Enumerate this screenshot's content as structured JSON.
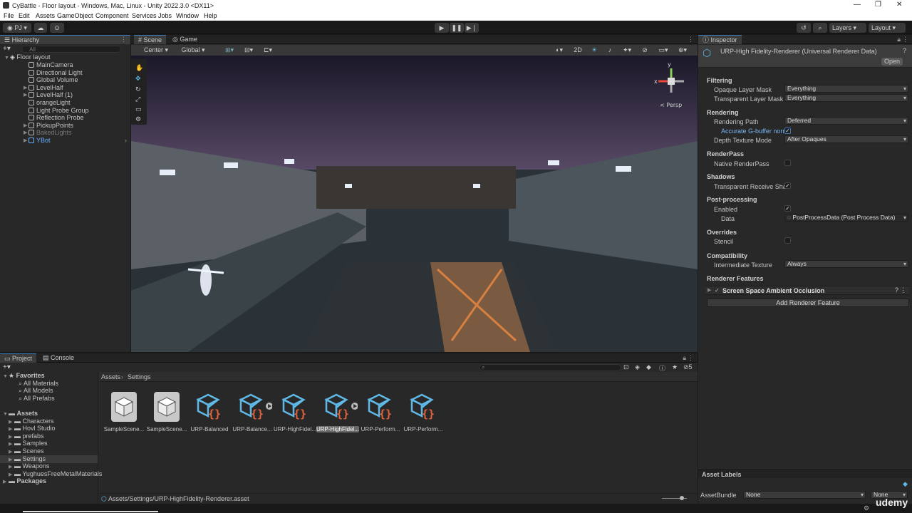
{
  "window": {
    "title": "CyBattle - Floor layout - Windows, Mac, Linux - Unity 2022.3.0 <DX11>"
  },
  "menu": [
    "File",
    "Edit",
    "Assets",
    "GameObject",
    "Component",
    "Services",
    "Jobs",
    "Window",
    "Help"
  ],
  "toolbar": {
    "account": "PJ",
    "layers": "Layers",
    "layout": "Layout"
  },
  "hierarchy": {
    "tab": "Hierarchy",
    "search_placeholder": "All",
    "root": "Floor layout",
    "items": [
      {
        "label": "MainCamera",
        "arrow": false,
        "dim": false,
        "blue": false
      },
      {
        "label": "Directional Light",
        "arrow": false,
        "dim": false,
        "blue": false
      },
      {
        "label": "Global Volume",
        "arrow": false,
        "dim": false,
        "blue": false
      },
      {
        "label": "LevelHalf",
        "arrow": true,
        "dim": false,
        "blue": false
      },
      {
        "label": "LevelHalf (1)",
        "arrow": true,
        "dim": false,
        "blue": false
      },
      {
        "label": "orangeLight",
        "arrow": false,
        "dim": false,
        "blue": false
      },
      {
        "label": "Light Probe Group",
        "arrow": false,
        "dim": false,
        "blue": false
      },
      {
        "label": "Reflection Probe",
        "arrow": false,
        "dim": false,
        "blue": false
      },
      {
        "label": "PickupPoints",
        "arrow": true,
        "dim": false,
        "blue": false
      },
      {
        "label": "BakedLights",
        "arrow": true,
        "dim": true,
        "blue": false
      },
      {
        "label": "YBot",
        "arrow": true,
        "dim": false,
        "blue": true
      }
    ]
  },
  "scene": {
    "tab_scene": "Scene",
    "tab_game": "Game",
    "pivot": "Center",
    "space": "Global",
    "mode2d": "2D",
    "persp": "< Persp",
    "gizmo_x": "x",
    "gizmo_y": "y"
  },
  "inspector": {
    "tab": "Inspector",
    "title": "URP-High Fidelity-Renderer (Universal Renderer Data)",
    "open": "Open",
    "filtering": "Filtering",
    "opaque_label": "Opaque Layer Mask",
    "opaque_value": "Everything",
    "transparent_label": "Transparent Layer Mask",
    "transparent_value": "Everything",
    "rendering": "Rendering",
    "path_label": "Rendering Path",
    "path_value": "Deferred",
    "gbuffer_label": "Accurate G-buffer norm",
    "depth_label": "Depth Texture Mode",
    "depth_value": "After Opaques",
    "renderpass": "RenderPass",
    "native_label": "Native RenderPass",
    "shadows": "Shadows",
    "trs_label": "Transparent Receive Shac",
    "post": "Post-processing",
    "enabled_label": "Enabled",
    "data_label": "Data",
    "data_value": "PostProcessData (Post Process Data)",
    "overrides": "Overrides",
    "stencil_label": "Stencil",
    "compat": "Compatibility",
    "intermediate_label": "Intermediate Texture",
    "intermediate_value": "Always",
    "features": "Renderer Features",
    "feature1": "Screen Space Ambient Occlusion",
    "add_feature": "Add Renderer Feature",
    "asset_labels": "Asset Labels",
    "assetbundle": "AssetBundle",
    "ab_value": "None",
    "ab_variant": "None"
  },
  "project": {
    "tab_project": "Project",
    "tab_console": "Console",
    "breadcrumb_root": "Assets",
    "breadcrumb_current": "Settings",
    "badge": "5",
    "favorites": "Favorites",
    "fav_items": [
      "All Materials",
      "All Models",
      "All Prefabs"
    ],
    "assets_root": "Assets",
    "folders": [
      "Characters",
      "Hovl Studio",
      "prefabs",
      "Samples",
      "Scenes",
      "Settings",
      "Weapons",
      "YughuesFreeMetalMaterials"
    ],
    "packages": "Packages",
    "assets": [
      {
        "label": "SampleScene...",
        "kind": "scene"
      },
      {
        "label": "SampleScene...",
        "kind": "scene"
      },
      {
        "label": "URP-Balanced",
        "kind": "renderer"
      },
      {
        "label": "URP-Balance...",
        "kind": "renderer-play"
      },
      {
        "label": "URP-HighFidel...",
        "kind": "renderer"
      },
      {
        "label": "URP-HighFidel...",
        "kind": "renderer-play"
      },
      {
        "label": "URP-Perform...",
        "kind": "renderer"
      },
      {
        "label": "URP-Perform...",
        "kind": "renderer"
      }
    ],
    "selected_index": 5,
    "status_path": "Assets/Settings/URP-HighFidelity-Renderer.asset"
  },
  "watermark": "udemy",
  "colors": {
    "accent": "#3a79bb",
    "selection": "#2c5d87",
    "icon_blue": "#5fb8e6",
    "icon_orange": "#e8623a"
  }
}
